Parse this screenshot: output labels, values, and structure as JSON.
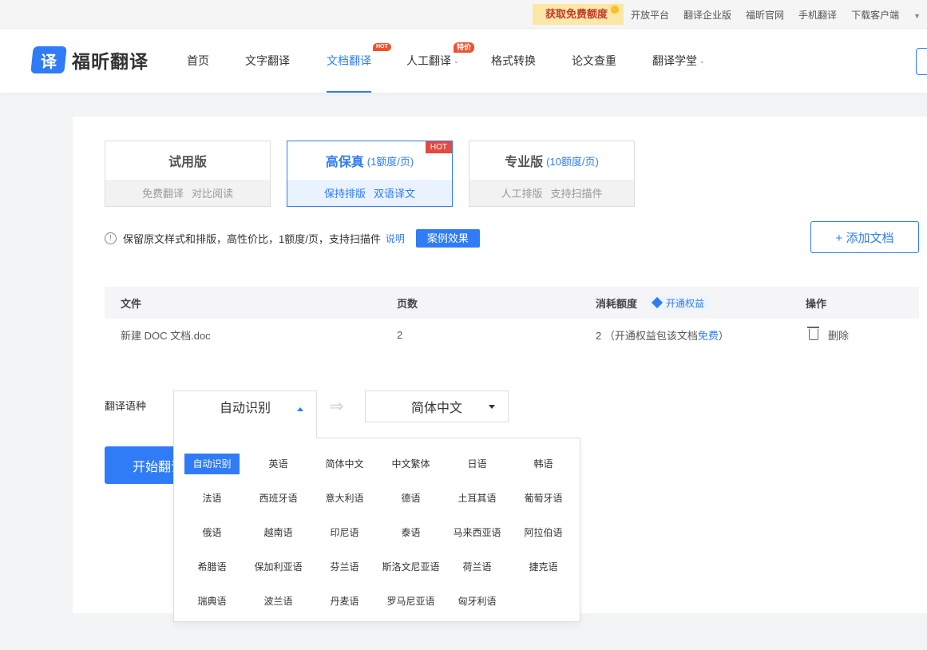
{
  "topbar": {
    "promo": "获取免费额度",
    "links": [
      "开放平台",
      "翻译企业版",
      "福昕官网",
      "手机翻译",
      "下载客户端"
    ]
  },
  "header": {
    "logo_glyph": "译",
    "logo_text": "福昕翻译",
    "nav": [
      {
        "label": "首页"
      },
      {
        "label": "文字翻译"
      },
      {
        "label": "文档翻译",
        "badge": "HOT",
        "active": true
      },
      {
        "label": "人工翻译",
        "badge": "特价",
        "dropdown": true
      },
      {
        "label": "格式转换"
      },
      {
        "label": "论文查重"
      },
      {
        "label": "翻译学堂",
        "dropdown": true
      }
    ]
  },
  "plans": [
    {
      "name": "试用版",
      "sub": "",
      "features": [
        "免费翻译",
        "对比阅读"
      ]
    },
    {
      "name": "高保真",
      "sub": "(1额度/页)",
      "features": [
        "保持排版",
        "双语译文"
      ],
      "badge": "HOT",
      "selected": true
    },
    {
      "name": "专业版",
      "sub": "(10额度/页)",
      "features": [
        "人工排版",
        "支持扫描件"
      ]
    }
  ],
  "info": {
    "text": "保留原文样式和排版，高性价比，1额度/页，支持扫描件",
    "link": "说明",
    "case_button": "案例效果",
    "add_button": "+ 添加文档"
  },
  "table": {
    "headers": {
      "file": "文件",
      "pages": "页数",
      "cost": "消耗额度",
      "vip": "开通权益",
      "action": "操作"
    },
    "rows": [
      {
        "file": "新建 DOC 文档.doc",
        "pages": "2",
        "cost_prefix": "2 （开通权益包该文档",
        "cost_free": "免费",
        "cost_suffix": "）",
        "action": "删除"
      }
    ]
  },
  "translate": {
    "label": "翻译语种",
    "source": "自动识别",
    "target": "简体中文",
    "start_button": "开始翻译"
  },
  "languages": [
    "自动识别",
    "英语",
    "简体中文",
    "中文繁体",
    "日语",
    "韩语",
    "法语",
    "西班牙语",
    "意大利语",
    "德语",
    "土耳其语",
    "葡萄牙语",
    "俄语",
    "越南语",
    "印尼语",
    "泰语",
    "马来西亚语",
    "阿拉伯语",
    "希腊语",
    "保加利亚语",
    "芬兰语",
    "斯洛文尼亚语",
    "荷兰语",
    "捷克语",
    "瑞典语",
    "波兰语",
    "丹麦语",
    "罗马尼亚语",
    "匈牙利语"
  ],
  "colors": {
    "accent": "#2f7cf6",
    "hot": "#e8483f"
  }
}
